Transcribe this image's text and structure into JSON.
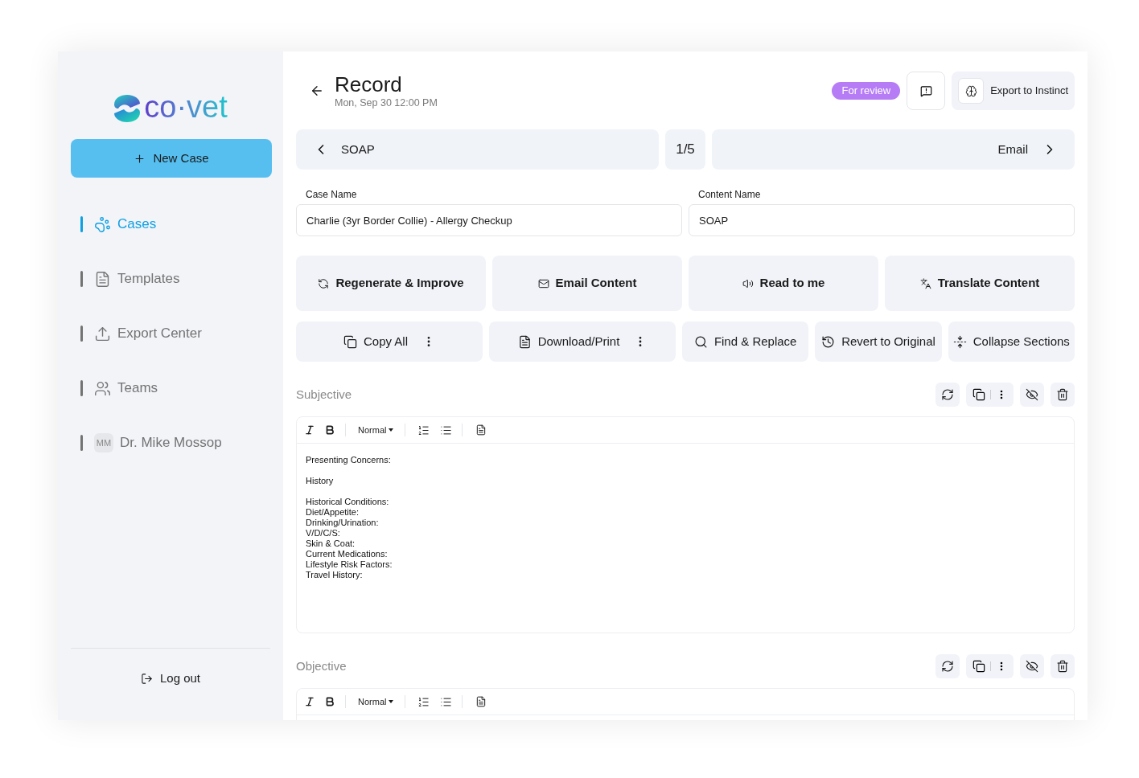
{
  "logo": {
    "text": "co·vet"
  },
  "new_case": {
    "label": "New Case"
  },
  "nav": [
    {
      "kind": "page",
      "label": "Cases",
      "selected": true
    },
    {
      "kind": "page",
      "label": "Templates",
      "selected": false
    },
    {
      "kind": "page",
      "label": "Export Center",
      "selected": false
    },
    {
      "kind": "page",
      "label": "Teams",
      "selected": false
    },
    {
      "kind": "user",
      "label": "Dr. Mike Mossop",
      "initials": "MM",
      "selected": false
    }
  ],
  "logout": {
    "label": "Log out"
  },
  "header": {
    "title": "Record",
    "subtitle": "Mon, Sep 30 12:00 PM",
    "status": "For review",
    "export_label": "Export to Instinct"
  },
  "pager": {
    "previous": "SOAP",
    "position": "1/5",
    "next": "Email"
  },
  "fields": [
    {
      "label": "Case Name",
      "value": "Charlie (3yr Border Collie) - Allergy Checkup"
    },
    {
      "label": "Content Name",
      "value": "SOAP"
    }
  ],
  "action_rows": [
    [
      {
        "label": "Regenerate & Improve",
        "menu": false
      },
      {
        "label": "Email Content",
        "menu": false
      },
      {
        "label": "Read to me",
        "menu": false
      },
      {
        "label": "Translate Content",
        "menu": false
      }
    ],
    [
      {
        "label": "Copy All",
        "menu": true
      },
      {
        "label": "Download/Print",
        "menu": true
      },
      {
        "label": "Find & Replace",
        "menu": false
      },
      {
        "label": "Revert to Original",
        "menu": false
      },
      {
        "label": "Collapse Sections",
        "menu": false
      }
    ]
  ],
  "sections": [
    {
      "title": "Subjective",
      "format": "Normal",
      "blocks": [
        [
          "Presenting Concerns:"
        ],
        [
          "History"
        ],
        [
          "Historical Conditions:",
          "Diet/Appetite:",
          "Drinking/Urination:",
          "V/D/C/S:",
          "Skin & Coat:",
          "Current Medications:",
          "Lifestyle Risk Factors:",
          "Travel History:"
        ]
      ]
    },
    {
      "title": "Objective",
      "format": "Normal"
    }
  ]
}
